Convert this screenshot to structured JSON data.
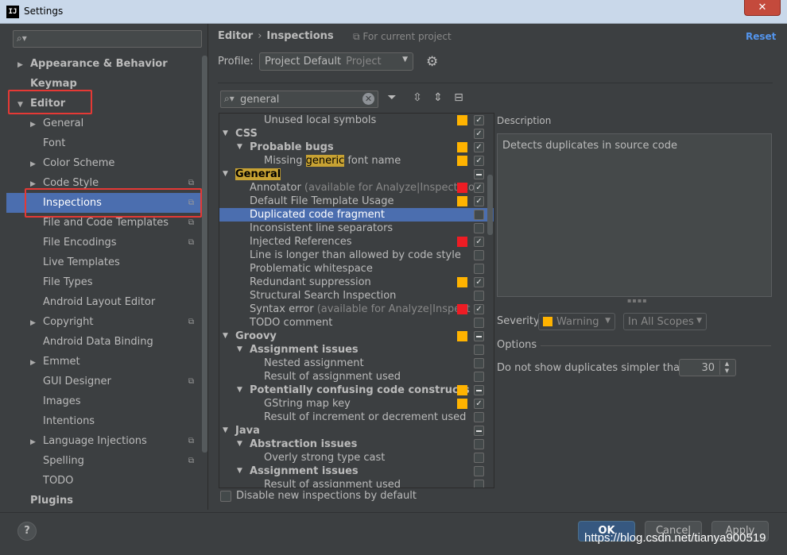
{
  "window": {
    "title": "Settings",
    "app_logo": "IJ",
    "close_icon": "✕"
  },
  "sidebar": {
    "search_placeholder": "",
    "items": [
      {
        "label": "Appearance & Behavior",
        "arrow": "▶",
        "bold": true,
        "indent": 0
      },
      {
        "label": "Keymap",
        "arrow": "",
        "bold": true,
        "indent": 0
      },
      {
        "label": "Editor",
        "arrow": "▼",
        "bold": true,
        "indent": 0
      },
      {
        "label": "General",
        "arrow": "▶",
        "indent": 1
      },
      {
        "label": "Font",
        "arrow": "",
        "indent": 1
      },
      {
        "label": "Color Scheme",
        "arrow": "▶",
        "indent": 1
      },
      {
        "label": "Code Style",
        "arrow": "▶",
        "indent": 1,
        "badge": true
      },
      {
        "label": "Inspections",
        "arrow": "",
        "indent": 1,
        "badge": true,
        "selected": true
      },
      {
        "label": "File and Code Templates",
        "arrow": "",
        "indent": 1,
        "badge": true
      },
      {
        "label": "File Encodings",
        "arrow": "",
        "indent": 1,
        "badge": true
      },
      {
        "label": "Live Templates",
        "arrow": "",
        "indent": 1
      },
      {
        "label": "File Types",
        "arrow": "",
        "indent": 1
      },
      {
        "label": "Android Layout Editor",
        "arrow": "",
        "indent": 1
      },
      {
        "label": "Copyright",
        "arrow": "▶",
        "indent": 1,
        "badge": true
      },
      {
        "label": "Android Data Binding",
        "arrow": "",
        "indent": 1
      },
      {
        "label": "Emmet",
        "arrow": "▶",
        "indent": 1
      },
      {
        "label": "GUI Designer",
        "arrow": "",
        "indent": 1,
        "badge": true
      },
      {
        "label": "Images",
        "arrow": "",
        "indent": 1
      },
      {
        "label": "Intentions",
        "arrow": "",
        "indent": 1
      },
      {
        "label": "Language Injections",
        "arrow": "▶",
        "indent": 1,
        "badge": true
      },
      {
        "label": "Spelling",
        "arrow": "",
        "indent": 1,
        "badge": true
      },
      {
        "label": "TODO",
        "arrow": "",
        "indent": 1
      },
      {
        "label": "Plugins",
        "arrow": "",
        "bold": true,
        "indent": 0
      }
    ]
  },
  "header": {
    "breadcrumb_parent": "Editor",
    "breadcrumb_separator": "›",
    "breadcrumb_current": "Inspections",
    "for_project": "For current project",
    "reset": "Reset"
  },
  "profile": {
    "label": "Profile:",
    "value": "Project Default",
    "scope": "Project"
  },
  "filter": {
    "value": "general"
  },
  "inspections": [
    {
      "label": "Unused local symbols",
      "level": 2,
      "sev": "warn",
      "chk": "on"
    },
    {
      "label": "CSS",
      "level": 0,
      "bold": true,
      "arrow": "▼",
      "chk": "on"
    },
    {
      "label": "Probable bugs",
      "level": 1,
      "bold": true,
      "arrow": "▼",
      "sev": "warn",
      "chk": "on"
    },
    {
      "pre": "Missing ",
      "hl": "generic",
      "post": " font name",
      "level": 2,
      "sev": "warn",
      "chk": "on"
    },
    {
      "hl": "General",
      "level": 0,
      "bold": true,
      "arrow": "▼",
      "chk": "mixed"
    },
    {
      "label": "Annotator ",
      "muted": "(available for Analyze|Inspect Coc",
      "level": 1,
      "sev": "err",
      "chk": "on"
    },
    {
      "label": "Default File Template Usage",
      "level": 1,
      "sev": "warn",
      "chk": "on"
    },
    {
      "label": "Duplicated code fragment",
      "level": 1,
      "chk": "off",
      "selected": true
    },
    {
      "label": "Inconsistent line separators",
      "level": 1,
      "chk": "off"
    },
    {
      "label": "Injected References",
      "level": 1,
      "sev": "err",
      "chk": "on"
    },
    {
      "label": "Line is longer than allowed by code style",
      "level": 1,
      "chk": "off"
    },
    {
      "label": "Problematic whitespace",
      "level": 1,
      "chk": "off"
    },
    {
      "label": "Redundant suppression",
      "level": 1,
      "sev": "warn",
      "chk": "on"
    },
    {
      "label": "Structural Search Inspection",
      "level": 1,
      "chk": "off"
    },
    {
      "label": "Syntax error ",
      "muted": "(available for Analyze|Inspect C",
      "level": 1,
      "sev": "err",
      "chk": "on"
    },
    {
      "label": "TODO comment",
      "level": 1,
      "chk": "off"
    },
    {
      "label": "Groovy",
      "level": 0,
      "bold": true,
      "arrow": "▼",
      "sev": "warn",
      "chk": "mixed"
    },
    {
      "label": "Assignment issues",
      "level": 1,
      "bold": true,
      "arrow": "▼",
      "chk": "off"
    },
    {
      "label": "Nested assignment",
      "level": 2,
      "chk": "off"
    },
    {
      "label": "Result of assignment used",
      "level": 2,
      "chk": "off"
    },
    {
      "label": "Potentially confusing code constructs",
      "level": 1,
      "bold": true,
      "arrow": "▼",
      "sev": "warn",
      "chk": "mixed"
    },
    {
      "label": "GString map key",
      "level": 2,
      "sev": "warn",
      "chk": "on"
    },
    {
      "label": "Result of increment or decrement used",
      "level": 2,
      "chk": "off"
    },
    {
      "label": "Java",
      "level": 0,
      "bold": true,
      "arrow": "▼",
      "chk": "mixed"
    },
    {
      "label": "Abstraction issues",
      "level": 1,
      "bold": true,
      "arrow": "▼",
      "chk": "off"
    },
    {
      "label": "Overly strong type cast",
      "level": 2,
      "chk": "off"
    },
    {
      "label": "Assignment issues",
      "level": 1,
      "bold": true,
      "arrow": "▼",
      "chk": "off"
    },
    {
      "label": "Result of assignment used",
      "level": 2,
      "chk": "off"
    }
  ],
  "disable_new": "Disable new inspections by default",
  "description": {
    "label": "Description",
    "text": "Detects duplicates in source code"
  },
  "severity": {
    "label": "Severity:",
    "value": "Warning",
    "scope": "In All Scopes"
  },
  "options": {
    "label": "Options",
    "dup_label": "Do not show duplicates simpler than:",
    "dup_value": "30"
  },
  "buttons": {
    "help": "?",
    "ok": "OK",
    "cancel": "Cancel",
    "apply": "Apply"
  },
  "watermark": "https://blog.csdn.net/tianya900519",
  "colors": {
    "accent": "#4b6eaf",
    "warning": "#ffb300",
    "error": "#ee1c24",
    "annotation_box": "#e53935",
    "link": "#5394ec"
  }
}
